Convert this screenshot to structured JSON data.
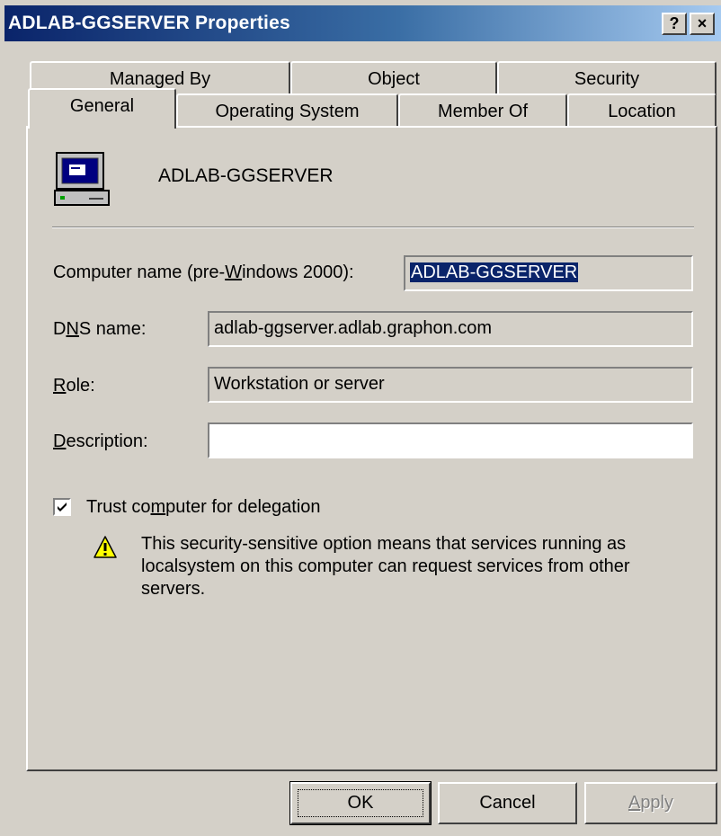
{
  "window": {
    "title": "ADLAB-GGSERVER Properties",
    "help_label": "?",
    "close_label": "×"
  },
  "tabs": {
    "row1": [
      "Managed By",
      "Object",
      "Security"
    ],
    "row2": [
      "General",
      "Operating System",
      "Member Of",
      "Location"
    ],
    "active": "General"
  },
  "general": {
    "computer_display_name": "ADLAB-GGSERVER",
    "computer_name_label": {
      "pre": "Computer name (pre-",
      "key": "W",
      "post": "indows 2000):"
    },
    "computer_name_value": "ADLAB-GGSERVER",
    "dns_name_label": {
      "pre": "D",
      "key": "N",
      "post": "S name:"
    },
    "dns_name_value": "adlab-ggserver.adlab.graphon.com",
    "role_label": {
      "pre": "",
      "key": "R",
      "post": "ole:"
    },
    "role_value": "Workstation or server",
    "description_label": {
      "pre": "",
      "key": "D",
      "post": "escription:"
    },
    "description_value": "",
    "trust_label": {
      "pre": "Trust co",
      "key": "m",
      "post": "puter for delegation"
    },
    "trust_checked": true,
    "warning_text": "This security-sensitive option means that services running as localsystem on this computer can request services from other servers."
  },
  "buttons": {
    "ok": "OK",
    "cancel": "Cancel",
    "apply": {
      "pre": "",
      "key": "A",
      "post": "pply"
    }
  },
  "colors": {
    "title_start": "#0a246a",
    "title_end": "#a6caf0",
    "face": "#d4d0c8",
    "selection": "#0a246a"
  }
}
